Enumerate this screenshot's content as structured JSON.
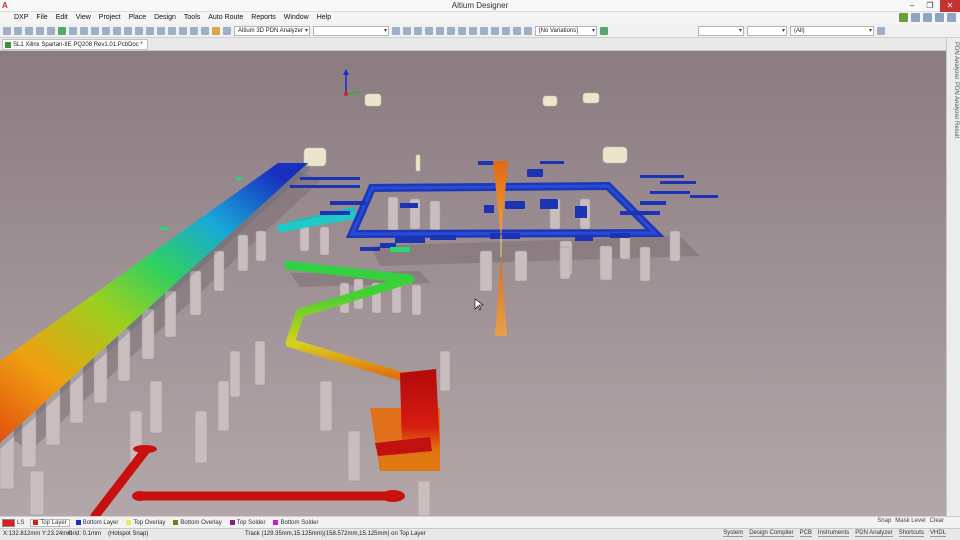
{
  "window": {
    "title": "Altium Designer",
    "app_icon_glyph": "A"
  },
  "menu": [
    "DXP",
    "File",
    "Edit",
    "View",
    "Project",
    "Place",
    "Design",
    "Tools",
    "Auto Route",
    "Reports",
    "Window",
    "Help"
  ],
  "toolbar": {
    "analyzer_combo": "Altium 3D PDN Analyzer",
    "blank_combo": "",
    "variations_combo": "[No Variations]",
    "filter_combo_1": "",
    "filter_combo_2": "",
    "all_combo": "(All)"
  },
  "doc_tab": {
    "label": "SL1 Xilinx Spartan-IIE PQ208 Rev1.01.PcbDoc *"
  },
  "side_panel": {
    "tab_1": "PDN Analyzer",
    "tab_2": "PDN Analyzer Result"
  },
  "layers": {
    "ls_label": "LS",
    "tabs": [
      {
        "name": "Top Layer",
        "color": "#d91c1c"
      },
      {
        "name": "Bottom Layer",
        "color": "#1c2ec8"
      },
      {
        "name": "Top Overlay",
        "color": "#f5e35c"
      },
      {
        "name": "Bottom Overlay",
        "color": "#7a7a1a"
      },
      {
        "name": "Top Solder",
        "color": "#8a1c8a"
      },
      {
        "name": "Bottom Solder",
        "color": "#c81cc8"
      }
    ],
    "right": [
      "Snap",
      "Mask Level",
      "Clear"
    ]
  },
  "status": {
    "coords": "X:132.812mm Y:23.24mm",
    "grid": "Grid: 0.1mm",
    "snap": "(Hotspot Snap)",
    "track": "Track (129.35mm,15.125mm)(158.572mm,15.125mm) on Top Layer",
    "panels": [
      "System",
      "Design Compiler",
      "PCB",
      "Instruments",
      "PDN Analyzer",
      "Shortcuts",
      "VHDL"
    ]
  },
  "colors": {
    "background_top": "#8a7b80",
    "background_bottom": "#b3a7a9",
    "trace_blue": "#1434b4",
    "trace_red": "#c81010",
    "trace_orange": "#e07010"
  }
}
